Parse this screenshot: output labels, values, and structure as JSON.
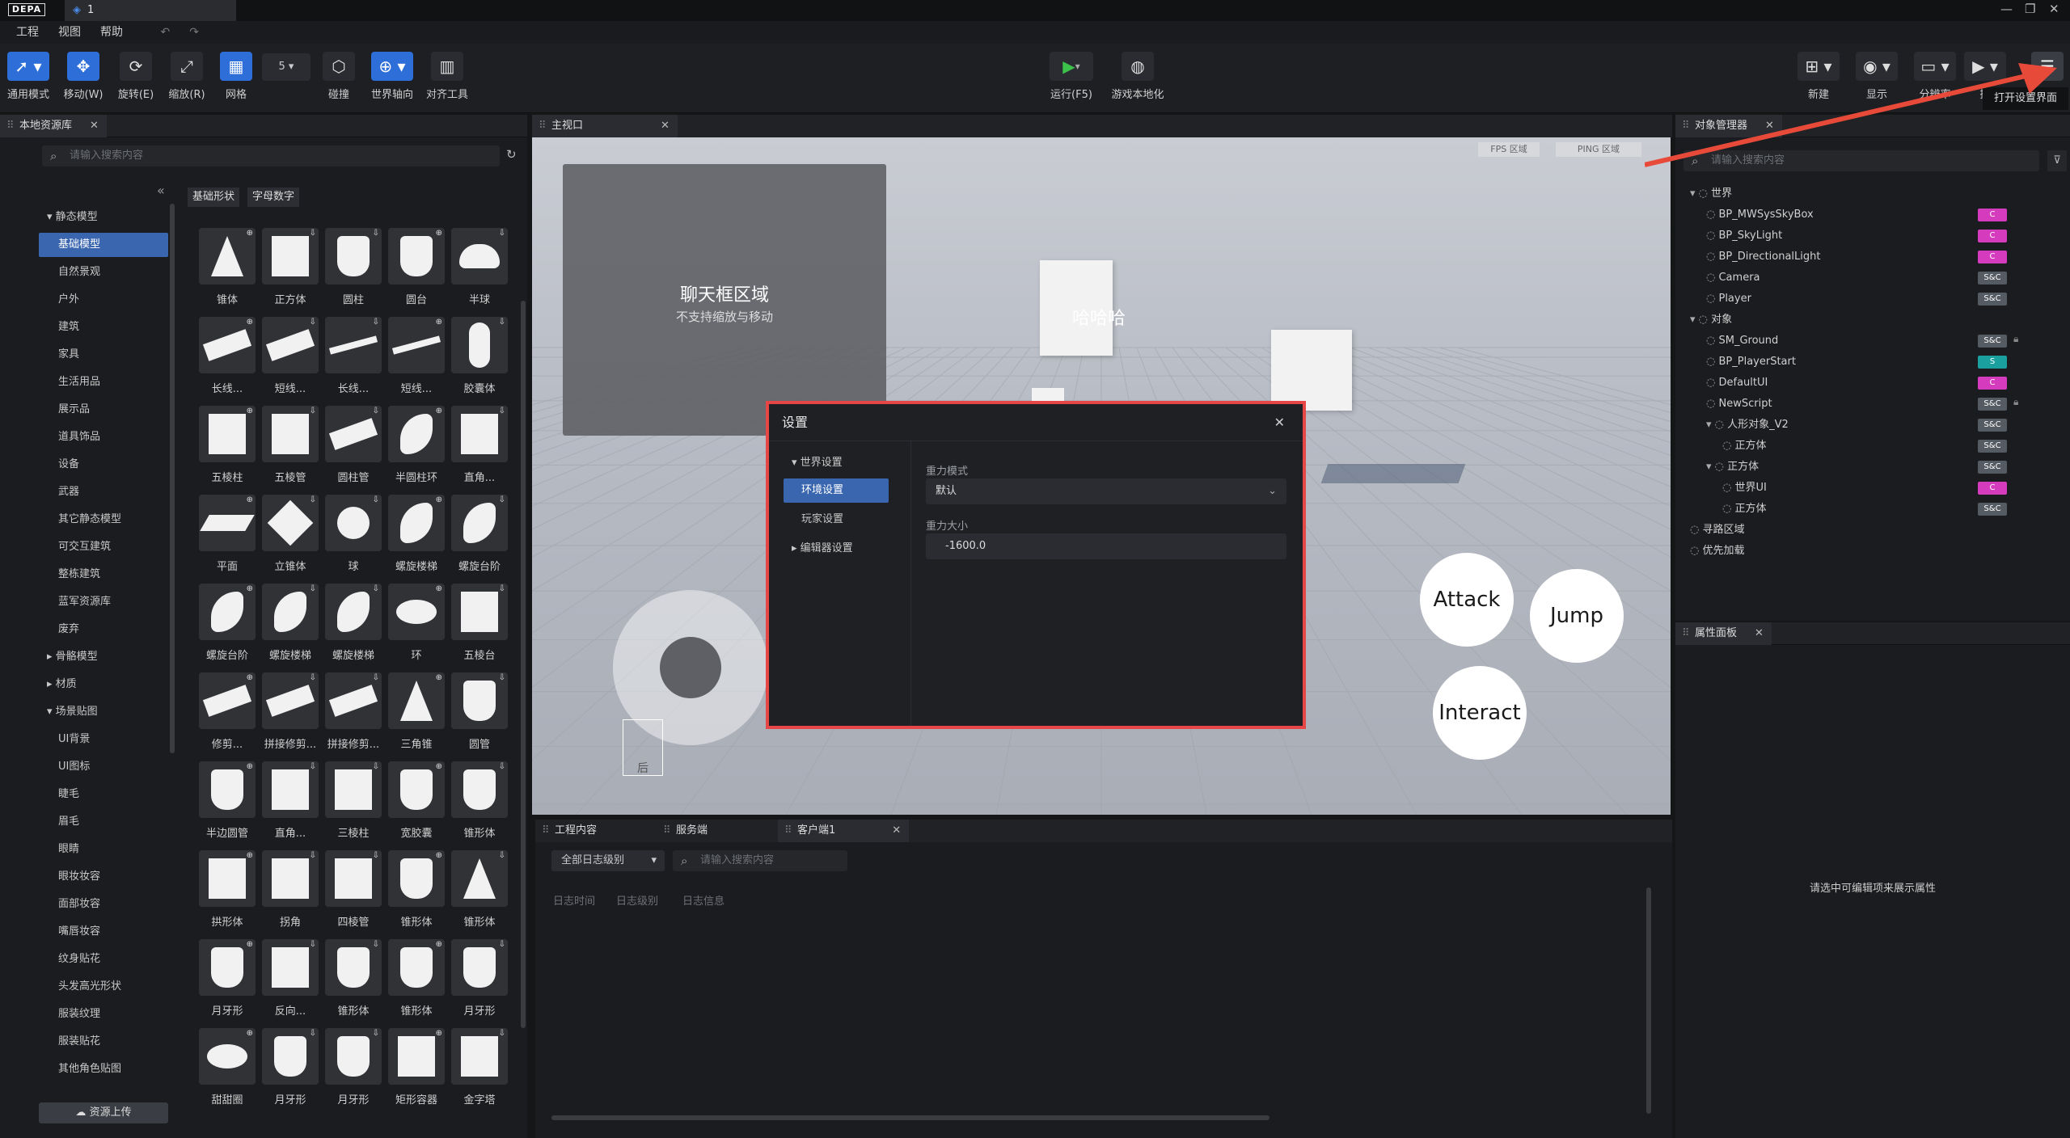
{
  "titlebar": {
    "logo": "DEPA",
    "tab_label": "1",
    "win_min": "—",
    "win_max": "❐",
    "win_close": "✕"
  },
  "menu": [
    "工程",
    "视图",
    "帮助"
  ],
  "toolbar": {
    "tools": [
      {
        "label": "通用模式",
        "icon": "cursor-icon"
      },
      {
        "label": "移动(W)",
        "icon": "move-icon"
      },
      {
        "label": "旋转(E)",
        "icon": "rotate-icon"
      },
      {
        "label": "缩放(R)",
        "icon": "scale-icon"
      },
      {
        "label": "网格",
        "icon": "grid-icon"
      }
    ],
    "grid_size": "5",
    "tools2": [
      {
        "label": "碰撞",
        "icon": "collision-icon"
      },
      {
        "label": "世界轴向",
        "icon": "world-axis-icon"
      },
      {
        "label": "对齐工具",
        "icon": "align-icon"
      }
    ],
    "run_label": "运行(F5)",
    "localize_label": "游戏本地化",
    "right_tools": [
      {
        "label": "新建",
        "icon": "new-icon"
      },
      {
        "label": "显示",
        "icon": "eye-icon"
      },
      {
        "label": "分辨率",
        "icon": "monitor-icon"
      },
      {
        "label": "摄",
        "icon": "camera-icon"
      }
    ],
    "settings_tooltip": "打开设置界面"
  },
  "asset_panel": {
    "tab": "本地资源库",
    "search_placeholder": "请输入搜索内容",
    "filter_chips": [
      "基础形状",
      "字母数字"
    ],
    "categories": [
      {
        "label": "静态模型",
        "type": "group",
        "open": true
      },
      {
        "label": "基础模型",
        "selected": true
      },
      {
        "label": "自然景观"
      },
      {
        "label": "户外"
      },
      {
        "label": "建筑"
      },
      {
        "label": "家具"
      },
      {
        "label": "生活用品"
      },
      {
        "label": "展示品"
      },
      {
        "label": "道具饰品"
      },
      {
        "label": "设备"
      },
      {
        "label": "武器"
      },
      {
        "label": "其它静态模型"
      },
      {
        "label": "可交互建筑"
      },
      {
        "label": "整栋建筑"
      },
      {
        "label": "蓝军资源库"
      },
      {
        "label": "废弃"
      },
      {
        "label": "骨骼模型",
        "type": "group",
        "open": false
      },
      {
        "label": "材质",
        "type": "group",
        "open": false
      },
      {
        "label": "场景贴图",
        "type": "group",
        "open": true
      },
      {
        "label": "UI背景"
      },
      {
        "label": "UI图标"
      },
      {
        "label": "睫毛"
      },
      {
        "label": "眉毛"
      },
      {
        "label": "眼睛"
      },
      {
        "label": "眼妆妆容"
      },
      {
        "label": "面部妆容"
      },
      {
        "label": "嘴唇妆容"
      },
      {
        "label": "纹身贴花"
      },
      {
        "label": "头发高光形状"
      },
      {
        "label": "服装纹理"
      },
      {
        "label": "服装贴花"
      },
      {
        "label": "其他角色贴图"
      }
    ],
    "upload_label": "资源上传",
    "assets": [
      "锥体",
      "正方体",
      "圆柱",
      "圆台",
      "半球",
      "长线...",
      "短线...",
      "长线...",
      "短线...",
      "胶囊体",
      "五棱柱",
      "五棱管",
      "圆柱管",
      "半圆柱环",
      "直角...",
      "平面",
      "立锥体",
      "球",
      "螺旋楼梯",
      "螺旋台阶",
      "螺旋台阶",
      "螺旋楼梯",
      "螺旋楼梯",
      "环",
      "五棱台",
      "修剪...",
      "拼接修剪...",
      "拼接修剪...",
      "三角锥",
      "圆管",
      "半边圆管",
      "直角...",
      "三棱柱",
      "宽胶囊",
      "锥形体",
      "拱形体",
      "拐角",
      "四棱管",
      "锥形体",
      "锥形体",
      "月牙形",
      "反向...",
      "锥形体",
      "锥形体",
      "月牙形",
      "甜甜圈",
      "月牙形",
      "月牙形",
      "矩形容器",
      "金字塔"
    ]
  },
  "viewport": {
    "tab": "主视口",
    "fps_label": "FPS 区域",
    "ping_label": "PING 区域",
    "chat_title": "聊天框区域",
    "chat_sub": "不支持缩放与移动",
    "float_text": "哈哈哈",
    "buttons": [
      "Attack",
      "Jump",
      "Interact"
    ],
    "back_label": "后"
  },
  "settings_dialog": {
    "title": "设置",
    "nav": [
      {
        "label": "世界设置",
        "type": "group"
      },
      {
        "label": "环境设置",
        "selected": true
      },
      {
        "label": "玩家设置"
      },
      {
        "label": "编辑器设置",
        "type": "group"
      }
    ],
    "gravity_mode_label": "重力模式",
    "gravity_mode_value": "默认",
    "gravity_size_label": "重力大小",
    "gravity_size_value": "-1600.0"
  },
  "log_panel": {
    "tabs": [
      "工程内容",
      "服务端",
      "客户端1"
    ],
    "level_select": "全部日志级别",
    "search_placeholder": "请输入搜索内容",
    "columns": [
      "日志时间",
      "日志级别",
      "日志信息"
    ]
  },
  "object_panel": {
    "tab": "对象管理器",
    "search_placeholder": "请输入搜索内容",
    "tree": [
      {
        "label": "世界",
        "depth": 0,
        "group": true
      },
      {
        "label": "BP_MWSysSkyBox",
        "depth": 1,
        "badge": "C",
        "color": "m"
      },
      {
        "label": "BP_SkyLight",
        "depth": 1,
        "badge": "C",
        "color": "m"
      },
      {
        "label": "BP_DirectionalLight",
        "depth": 1,
        "badge": "C",
        "color": "m"
      },
      {
        "label": "Camera",
        "depth": 1,
        "badge": "S&C",
        "color": "g"
      },
      {
        "label": "Player",
        "depth": 1,
        "badge": "S&C",
        "color": "g"
      },
      {
        "label": "对象",
        "depth": 0,
        "group": true
      },
      {
        "label": "SM_Ground",
        "depth": 1,
        "badge": "S&C",
        "color": "g",
        "lock": true
      },
      {
        "label": "BP_PlayerStart",
        "depth": 1,
        "badge": "S",
        "color": "t"
      },
      {
        "label": "DefaultUI",
        "depth": 1,
        "badge": "C",
        "color": "m"
      },
      {
        "label": "NewScript",
        "depth": 1,
        "badge": "S&C",
        "color": "g",
        "lock": true
      },
      {
        "label": "人形对象_V2",
        "depth": 1,
        "badge": "S&C",
        "color": "g",
        "group": true
      },
      {
        "label": "正方体",
        "depth": 2,
        "badge": "S&C",
        "color": "g"
      },
      {
        "label": "正方体",
        "depth": 1,
        "badge": "S&C",
        "color": "g",
        "group": true
      },
      {
        "label": "世界UI",
        "depth": 2,
        "badge": "C",
        "color": "m"
      },
      {
        "label": "正方体",
        "depth": 2,
        "badge": "S&C",
        "color": "g"
      },
      {
        "label": "寻路区域",
        "depth": 0
      },
      {
        "label": "优先加载",
        "depth": 0
      }
    ]
  },
  "property_panel": {
    "tab": "属性面板",
    "empty_text": "请选中可编辑项来展示属性"
  }
}
